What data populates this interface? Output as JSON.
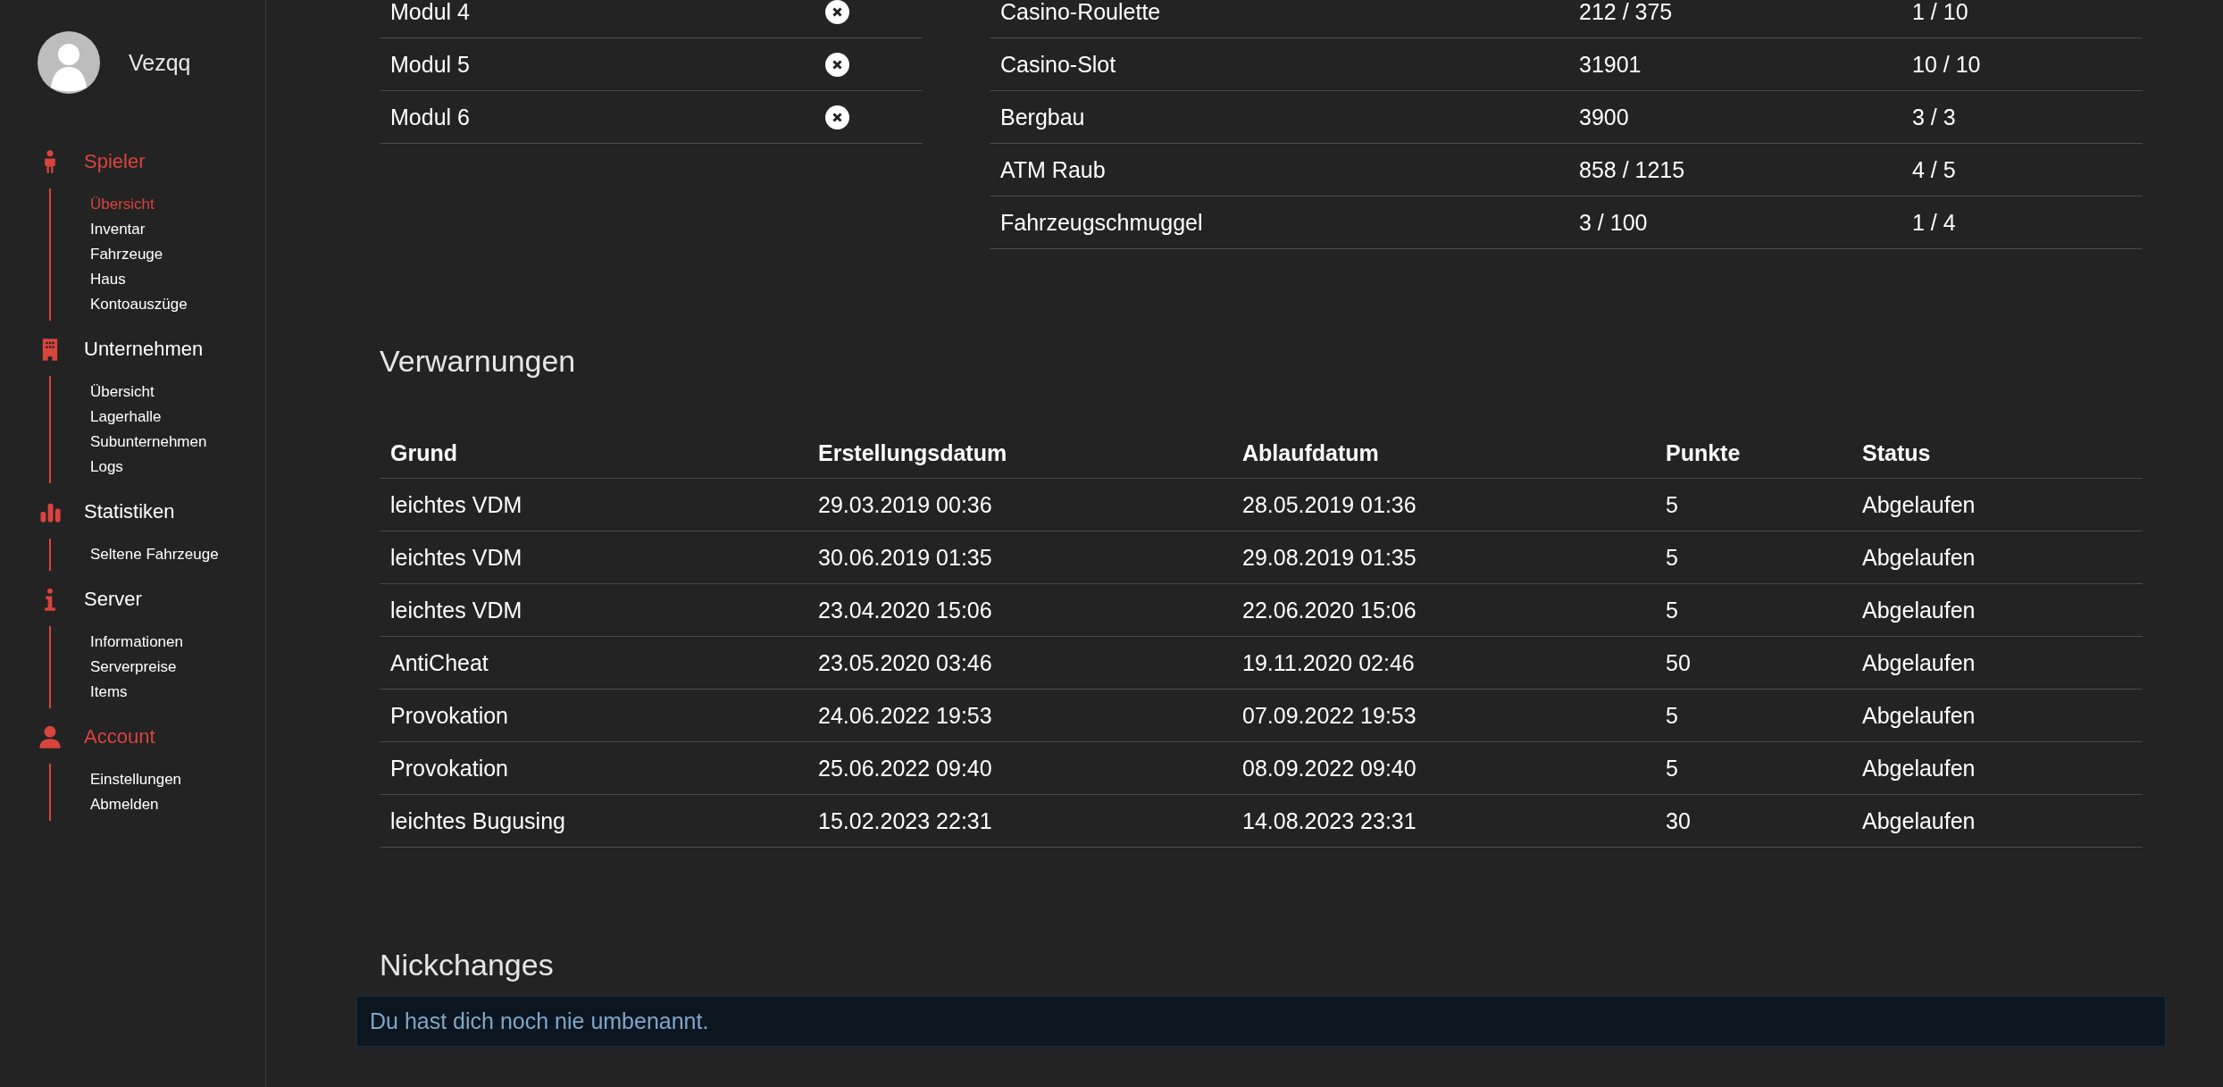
{
  "user": {
    "name": "Vezqq"
  },
  "sidebar": [
    {
      "title": "Spieler",
      "selected": true,
      "items": [
        {
          "label": "Übersicht",
          "selected": true
        },
        {
          "label": "Inventar",
          "selected": false
        },
        {
          "label": "Fahrzeuge",
          "selected": false
        },
        {
          "label": "Haus",
          "selected": false
        },
        {
          "label": "Kontoauszüge",
          "selected": false
        }
      ]
    },
    {
      "title": "Unternehmen",
      "selected": false,
      "items": [
        {
          "label": "Übersicht",
          "selected": false
        },
        {
          "label": "Lagerhalle",
          "selected": false
        },
        {
          "label": "Subunternehmen",
          "selected": false
        },
        {
          "label": "Logs",
          "selected": false
        }
      ]
    },
    {
      "title": "Statistiken",
      "selected": false,
      "items": [
        {
          "label": "Seltene Fahrzeuge",
          "selected": false
        }
      ]
    },
    {
      "title": "Server",
      "selected": false,
      "items": [
        {
          "label": "Informationen",
          "selected": false
        },
        {
          "label": "Serverpreise",
          "selected": false
        },
        {
          "label": "Items",
          "selected": false
        }
      ]
    },
    {
      "title": "Account",
      "selected": true,
      "items": [
        {
          "label": "Einstellungen",
          "selected": false
        },
        {
          "label": "Abmelden",
          "selected": false
        }
      ]
    }
  ],
  "modules": [
    {
      "name": "Modul 4",
      "completed": false
    },
    {
      "name": "Modul 5",
      "completed": false
    },
    {
      "name": "Modul 6",
      "completed": false
    }
  ],
  "activities": [
    [
      "Casino-Roulette",
      "212 / 375",
      "1 / 10"
    ],
    [
      "Casino-Slot",
      "31901",
      "10 / 10"
    ],
    [
      "Bergbau",
      "3900",
      "3 / 3"
    ],
    [
      "ATM Raub",
      "858 / 1215",
      "4 / 5"
    ],
    [
      "Fahrzeugschmuggel",
      "3 / 100",
      "1 / 4"
    ]
  ],
  "warnings": {
    "title": "Verwarnungen",
    "columns": [
      "Grund",
      "Erstellungsdatum",
      "Ablaufdatum",
      "Punkte",
      "Status"
    ],
    "rows": [
      [
        "leichtes VDM",
        "29.03.2019 00:36",
        "28.05.2019 01:36",
        "5",
        "Abgelaufen"
      ],
      [
        "leichtes VDM",
        "30.06.2019 01:35",
        "29.08.2019 01:35",
        "5",
        "Abgelaufen"
      ],
      [
        "leichtes VDM",
        "23.04.2020 15:06",
        "22.06.2020 15:06",
        "5",
        "Abgelaufen"
      ],
      [
        "AntiCheat",
        "23.05.2020 03:46",
        "19.11.2020 02:46",
        "50",
        "Abgelaufen"
      ],
      [
        "Provokation",
        "24.06.2022 19:53",
        "07.09.2022 19:53",
        "5",
        "Abgelaufen"
      ],
      [
        "Provokation",
        "25.06.2022 09:40",
        "08.09.2022 09:40",
        "5",
        "Abgelaufen"
      ],
      [
        "leichtes Bugusing",
        "15.02.2023 22:31",
        "14.08.2023 23:31",
        "30",
        "Abgelaufen"
      ]
    ]
  },
  "nickchanges": {
    "title": "Nickchanges",
    "message": "Du hast dich noch nie umbenannt."
  }
}
